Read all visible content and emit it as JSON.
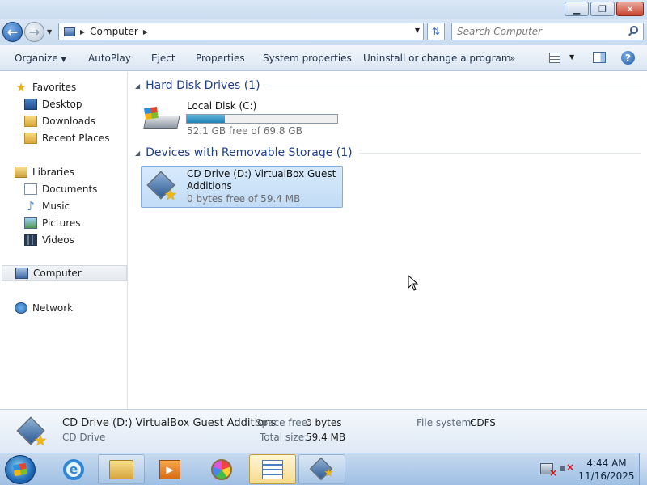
{
  "window": {
    "minimize_icon": "minimize-icon",
    "maximize_icon": "maximize-icon",
    "close_icon": "close-icon"
  },
  "address": {
    "location": "Computer",
    "search_placeholder": "Search Computer"
  },
  "toolbar": {
    "organize": "Organize",
    "autoplay": "AutoPlay",
    "eject": "Eject",
    "properties": "Properties",
    "system_properties": "System properties",
    "uninstall": "Uninstall or change a program",
    "more": "»"
  },
  "nav": {
    "favorites": "Favorites",
    "desktop": "Desktop",
    "downloads": "Downloads",
    "recent_places": "Recent Places",
    "libraries": "Libraries",
    "documents": "Documents",
    "music": "Music",
    "pictures": "Pictures",
    "videos": "Videos",
    "computer": "Computer",
    "network": "Network"
  },
  "groups": {
    "hard_disk": "Hard Disk Drives (1)",
    "removable": "Devices with Removable Storage (1)"
  },
  "drives": {
    "local": {
      "name": "Local Disk (C:)",
      "free_text": "52.1 GB free of 69.8 GB",
      "used_fraction": 0.25
    },
    "cd": {
      "name_line1": "CD Drive (D:) VirtualBox Guest",
      "name_line2": "Additions",
      "free_text": "0 bytes free of 59.4 MB"
    }
  },
  "details": {
    "title": "CD Drive (D:) VirtualBox Guest Additions",
    "type": "CD Drive",
    "space_free_label": "Space free:",
    "space_free_value": "0 bytes",
    "total_size_label": "Total size:",
    "total_size_value": "59.4 MB",
    "file_system_label": "File system:",
    "file_system_value": "CDFS"
  },
  "taskbar": {
    "time": "4:44 AM",
    "date": "11/16/2025"
  },
  "colors": {
    "group_header": "#1e3f8c",
    "selection": "#c2dcf5",
    "progress_fill": "#1f83b5"
  }
}
